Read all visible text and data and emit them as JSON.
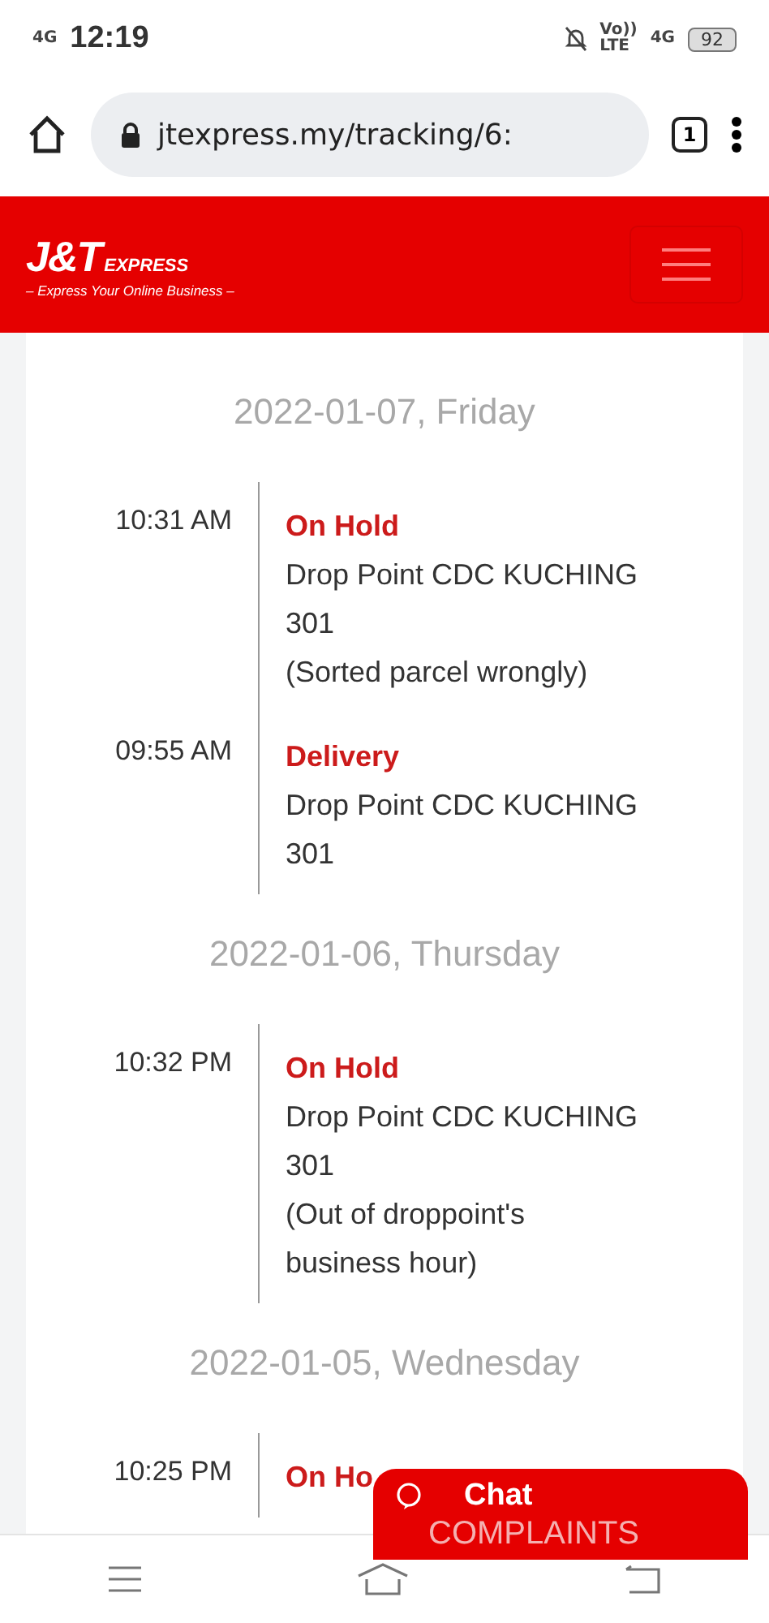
{
  "status_bar": {
    "network": "4G",
    "time": "12:19",
    "battery": "92",
    "network_right": "4G",
    "volte": "Vo))",
    "lte": "LTE"
  },
  "browser": {
    "url": "jtexpress.my/tracking/6:",
    "tab_count": "1"
  },
  "header": {
    "logo": "J&T",
    "logo_suffix": "EXPRESS",
    "tagline": "– Express Your Online Business –"
  },
  "days": [
    {
      "date": "2022-01-07, Friday",
      "events": [
        {
          "time": "10:31 AM",
          "status": "On Hold",
          "location": "Drop Point CDC KUCHING 301",
          "note": "(Sorted parcel wrongly)"
        },
        {
          "time": "09:55 AM",
          "status": "Delivery",
          "location": "Drop Point CDC KUCHING 301"
        }
      ]
    },
    {
      "date": "2022-01-06, Thursday",
      "events": [
        {
          "time": "10:32 PM",
          "status": "On Hold",
          "location": "Drop Point CDC KUCHING 301",
          "note": "(Out of droppoint's business hour)"
        }
      ]
    },
    {
      "date": "2022-01-05, Wednesday",
      "events": [
        {
          "time": "10:25 PM",
          "status": "On Ho"
        }
      ]
    }
  ],
  "chat": {
    "label": "Chat",
    "sublabel": "COMPLAINTS"
  }
}
